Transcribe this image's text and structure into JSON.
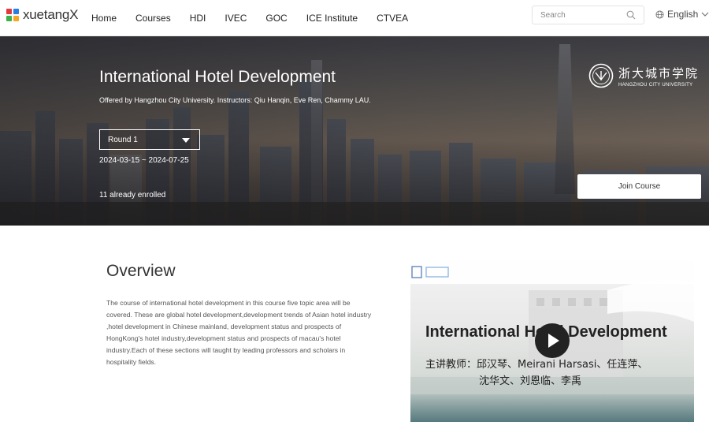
{
  "brand": {
    "name": "xuetangX",
    "colors": {
      "red": "#e4393c",
      "blue": "#2a7de1",
      "green": "#3cb34a",
      "orange": "#f5a623"
    }
  },
  "nav": {
    "items": [
      "Home",
      "Courses",
      "HDI",
      "IVEC",
      "GOC",
      "ICE Institute",
      "CTVEA"
    ],
    "search_placeholder": "Search",
    "language": "English"
  },
  "hero": {
    "title": "International Hotel Development",
    "offered": "Offered by Hangzhou City University. Instructors: Qiu Hanqin, Eve Ren, Chammy LAU.",
    "round": "Round 1",
    "dates": "2024-03-15 ~ 2024-07-25",
    "enrolled": "11 already enrolled",
    "join_label": "Join Course",
    "university_cn": "浙大城市学院",
    "university_en": "HANGZHOU CITY UNIVERSITY"
  },
  "overview": {
    "title": "Overview",
    "lines": [
      "The course of international hotel development in this course five topic area will be",
      "covered. These are global hotel development,development trends of Asian hotel industry",
      ",hotel development in Chinese mainland, development status and prospects of",
      "HongKong's hotel industry,development status and prospects of macau's hotel",
      "industry.Each of these sections will taught by leading professors and scholars in",
      "hospitality fields."
    ]
  },
  "video": {
    "title": "International Hotel Development",
    "instructors_line1": "主讲教师：邱汉琴、Meirani Harsasi、任连萍、",
    "instructors_line2": "沈华文、刘恩临、李禹"
  }
}
